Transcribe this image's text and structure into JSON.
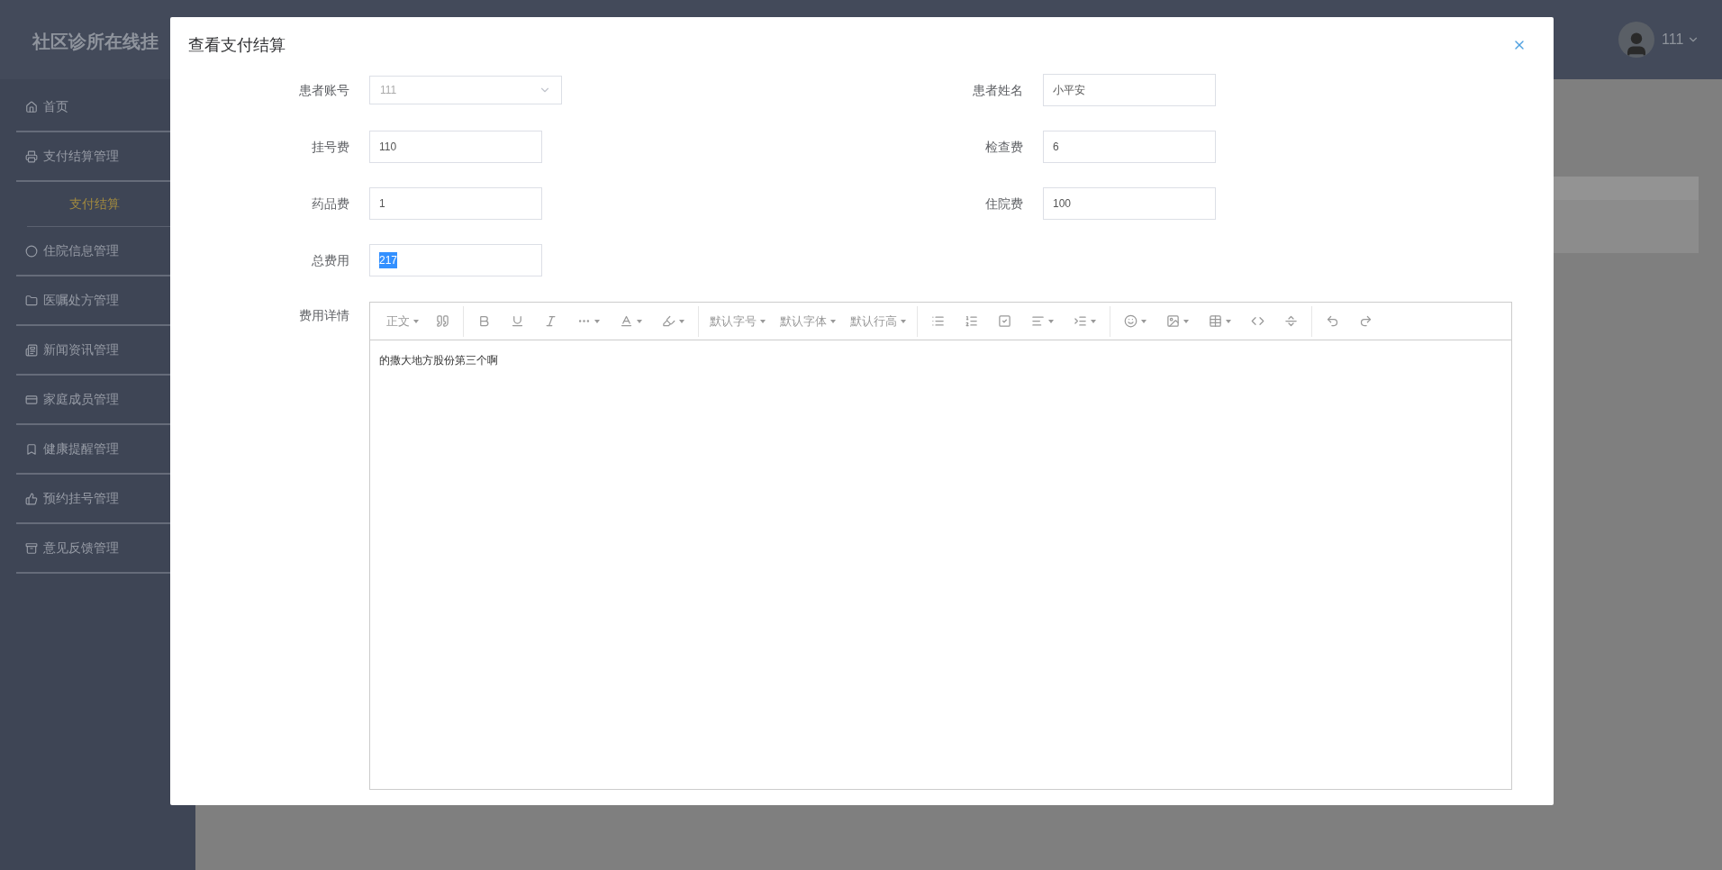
{
  "app": {
    "title": "社区诊所在线挂"
  },
  "user": {
    "name": "111"
  },
  "sidebar": {
    "items": [
      {
        "label": "首页",
        "selected": false
      },
      {
        "label": "支付结算管理",
        "selected": false,
        "children": [
          {
            "label": "支付结算",
            "selected": true
          }
        ]
      },
      {
        "label": "住院信息管理",
        "selected": false
      },
      {
        "label": "医嘱处方管理",
        "selected": false
      },
      {
        "label": "新闻资讯管理",
        "selected": false
      },
      {
        "label": "家庭成员管理",
        "selected": false
      },
      {
        "label": "健康提醒管理",
        "selected": false
      },
      {
        "label": "预约挂号管理",
        "selected": false
      },
      {
        "label": "意见反馈管理",
        "selected": false
      }
    ]
  },
  "dialog": {
    "title": "查看支付结算",
    "fields": [
      {
        "label": "患者账号",
        "kind": "select",
        "value": "111",
        "disabled": true,
        "text_selected": false
      },
      {
        "label": "患者姓名",
        "kind": "input",
        "value": "小平安",
        "disabled": false,
        "text_selected": false
      },
      {
        "label": "挂号费",
        "kind": "input",
        "value": "110",
        "disabled": false,
        "text_selected": false
      },
      {
        "label": "检查费",
        "kind": "input",
        "value": "6",
        "disabled": false,
        "text_selected": false
      },
      {
        "label": "药品费",
        "kind": "input",
        "value": "1",
        "disabled": false,
        "text_selected": false
      },
      {
        "label": "住院费",
        "kind": "input",
        "value": "100",
        "disabled": false,
        "text_selected": false
      },
      {
        "label": "总费用",
        "kind": "input",
        "value": "217",
        "disabled": false,
        "text_selected": true
      }
    ],
    "editor": {
      "label": "费用详情",
      "toolbar": [
        [
          {
            "kind": "text",
            "label": "正文",
            "dropdown": true
          },
          {
            "kind": "icon",
            "dropdown": false
          }
        ],
        [
          {
            "kind": "icon",
            "dropdown": false
          },
          {
            "kind": "icon",
            "dropdown": false
          },
          {
            "kind": "icon",
            "dropdown": false
          },
          {
            "kind": "icon",
            "dropdown": true
          },
          {
            "kind": "icon",
            "dropdown": true
          },
          {
            "kind": "icon",
            "dropdown": true
          }
        ],
        [
          {
            "kind": "text",
            "label": "默认字号",
            "dropdown": true
          },
          {
            "kind": "text",
            "label": "默认字体",
            "dropdown": true
          },
          {
            "kind": "text",
            "label": "默认行高",
            "dropdown": true
          }
        ],
        [
          {
            "kind": "icon",
            "dropdown": false
          },
          {
            "kind": "icon",
            "dropdown": false
          },
          {
            "kind": "icon",
            "dropdown": false
          },
          {
            "kind": "icon",
            "dropdown": true
          },
          {
            "kind": "icon",
            "dropdown": true
          }
        ],
        [
          {
            "kind": "icon",
            "dropdown": true
          },
          {
            "kind": "icon",
            "dropdown": true
          },
          {
            "kind": "icon",
            "dropdown": true
          },
          {
            "kind": "icon",
            "dropdown": false
          },
          {
            "kind": "icon",
            "dropdown": false
          }
        ],
        [
          {
            "kind": "icon",
            "dropdown": false
          },
          {
            "kind": "icon",
            "dropdown": false
          }
        ]
      ],
      "content": "的撒大地方股份第三个啊"
    }
  }
}
